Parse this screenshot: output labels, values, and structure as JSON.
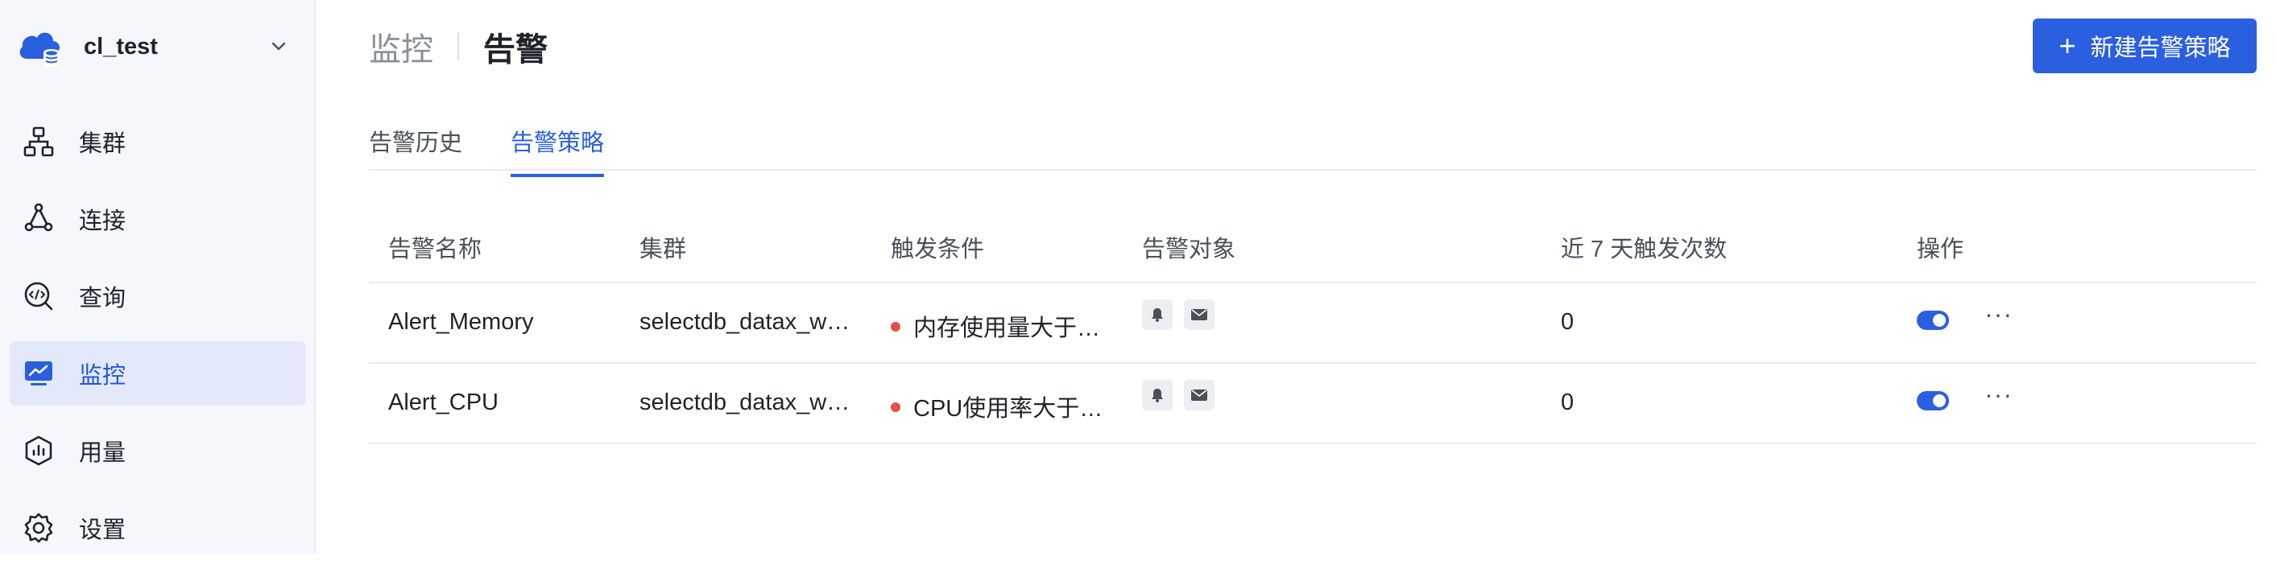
{
  "workspace": {
    "name": "cl_test"
  },
  "sidebar": {
    "items": [
      {
        "label": "集群",
        "icon": "cluster-icon"
      },
      {
        "label": "连接",
        "icon": "connection-icon"
      },
      {
        "label": "查询",
        "icon": "query-icon"
      },
      {
        "label": "监控",
        "icon": "monitor-icon",
        "active": true
      },
      {
        "label": "用量",
        "icon": "usage-icon"
      },
      {
        "label": "设置",
        "icon": "settings-icon"
      }
    ]
  },
  "header": {
    "parent": "监控",
    "title": "告警"
  },
  "actions": {
    "new_policy_label": "新建告警策略"
  },
  "tabs": [
    {
      "label": "告警历史"
    },
    {
      "label": "告警策略",
      "active": true
    }
  ],
  "table": {
    "columns": [
      "告警名称",
      "集群",
      "触发条件",
      "告警对象",
      "近 7 天触发次数",
      "操作"
    ],
    "rows": [
      {
        "name": "Alert_Memory",
        "cluster": "selectdb_datax_w…",
        "condition": "内存使用量大于…",
        "count": "0",
        "enabled": true
      },
      {
        "name": "Alert_CPU",
        "cluster": "selectdb_datax_w…",
        "condition": "CPU使用率大于…",
        "count": "0",
        "enabled": true
      }
    ]
  },
  "colors": {
    "accent": "#2a5fe0",
    "status_dot": "#e2504a",
    "sidebar_bg": "#f5f7fc",
    "active_bg": "#e3e9fb"
  }
}
